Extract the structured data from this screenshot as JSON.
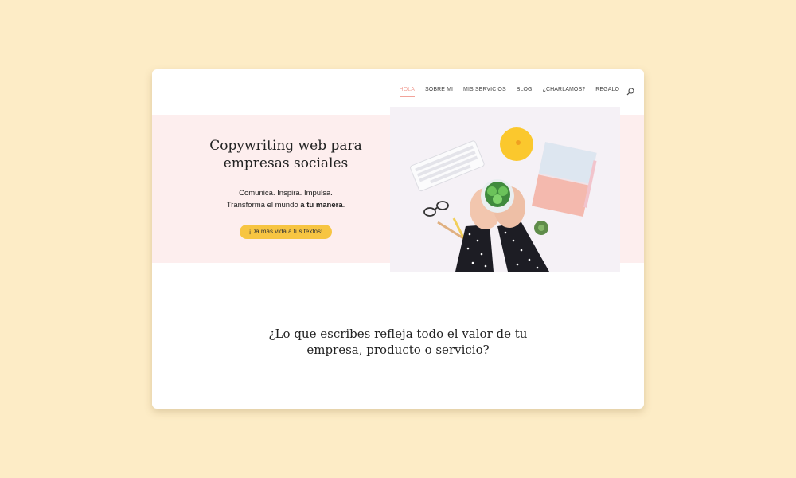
{
  "nav": {
    "items": [
      {
        "label": "HOLA",
        "active": true
      },
      {
        "label": "SOBRE MI",
        "active": false
      },
      {
        "label": "MIS SERVICIOS",
        "active": false
      },
      {
        "label": "BLOG",
        "active": false
      },
      {
        "label": "¿CHARLAMOS?",
        "active": false
      },
      {
        "label": "REGALO",
        "active": false
      }
    ],
    "search_icon": "search-icon"
  },
  "hero": {
    "title_line1": "Copywriting web para",
    "title_line2": "empresas sociales",
    "subtitle_line1": "Comunica. Inspira. Impulsa.",
    "subtitle_line2_prefix": "Transforma el mundo ",
    "subtitle_line2_bold": "a tu manera",
    "subtitle_line2_suffix": ".",
    "cta_label": "¡Da más vida a tus textos!"
  },
  "section": {
    "title_line1": "¿Lo que escribes refleja todo el valor de tu",
    "title_line2": "empresa, producto o servicio?"
  },
  "colors": {
    "background": "#fdecc6",
    "hero_band": "#fdeeee",
    "accent": "#f2a39a",
    "cta": "#f7c542"
  }
}
